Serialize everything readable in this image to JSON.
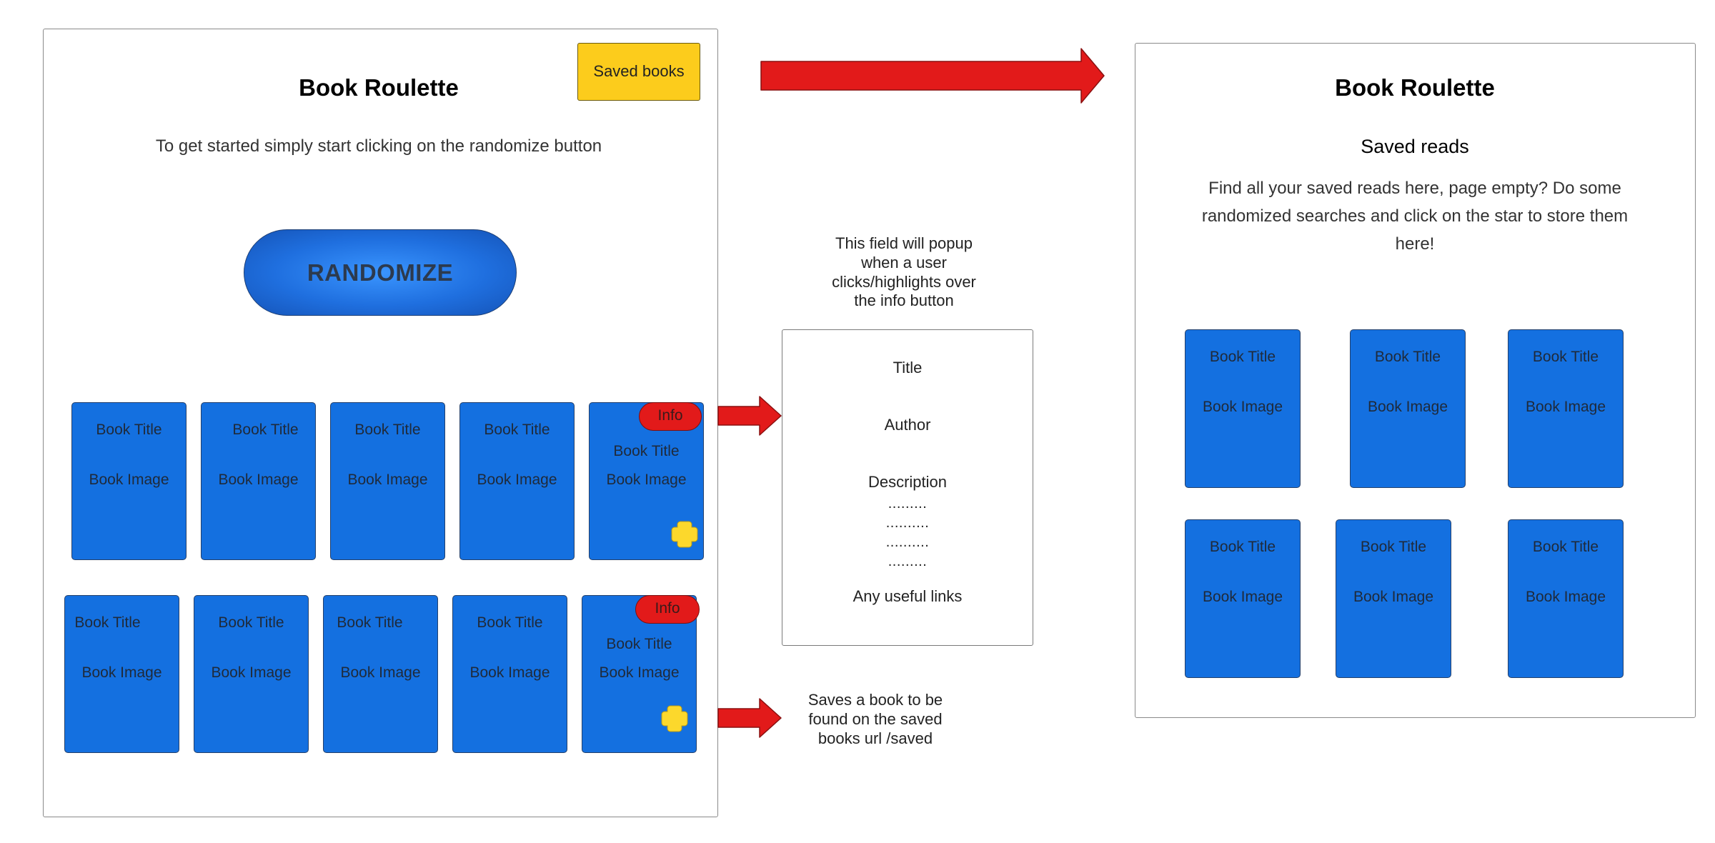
{
  "main_panel": {
    "title": "Book Roulette",
    "saved_books_label": "Saved books",
    "subtitle": "To get started simply start clicking on the randomize button",
    "randomize_label": "RANDOMIZE",
    "row1": [
      {
        "title": "Book Title",
        "image": "Book Image"
      },
      {
        "title": "Book Title",
        "image": "Book Image"
      },
      {
        "title": "Book Title",
        "image": "Book Image"
      },
      {
        "title": "Book Title",
        "image": "Book Image"
      },
      {
        "title": "Book Title",
        "image": "Book Image",
        "info": "Info"
      }
    ],
    "row2": [
      {
        "title": "Book Title",
        "image": "Book Image"
      },
      {
        "title": "Book Title",
        "image": "Book Image"
      },
      {
        "title": "Book Title",
        "image": "Book Image"
      },
      {
        "title": "Book Title",
        "image": "Book Image"
      },
      {
        "title": "Book Title",
        "image": "Book Image",
        "info": "Info"
      }
    ]
  },
  "annotations": {
    "popup_note": "This field will popup when a user clicks/highlights over the info button",
    "save_note": "Saves a book to be found on the saved books url /saved"
  },
  "info_popup": {
    "title": "Title",
    "author": "Author",
    "description": "Description",
    "dots": [
      ".........",
      "..........",
      "..........",
      "........."
    ],
    "links": "Any useful links"
  },
  "saved_panel": {
    "title": "Book Roulette",
    "heading": "Saved reads",
    "description": "Find all your saved reads here, page empty? Do some randomized searches and click on the star to store them here!",
    "cards": [
      {
        "title": "Book Title",
        "image": "Book Image"
      },
      {
        "title": "Book Title",
        "image": "Book Image"
      },
      {
        "title": "Book Title",
        "image": "Book Image"
      },
      {
        "title": "Book Title",
        "image": "Book Image"
      },
      {
        "title": "Book Title",
        "image": "Book Image"
      },
      {
        "title": "Book Title",
        "image": "Book Image"
      }
    ]
  },
  "colors": {
    "card": "#1470e0",
    "arrow": "#e21a1a",
    "saved_button": "#fccc1c",
    "star": "#fcd82c"
  },
  "icons": {
    "star": "star-icon",
    "arrow": "arrow-right-icon"
  }
}
